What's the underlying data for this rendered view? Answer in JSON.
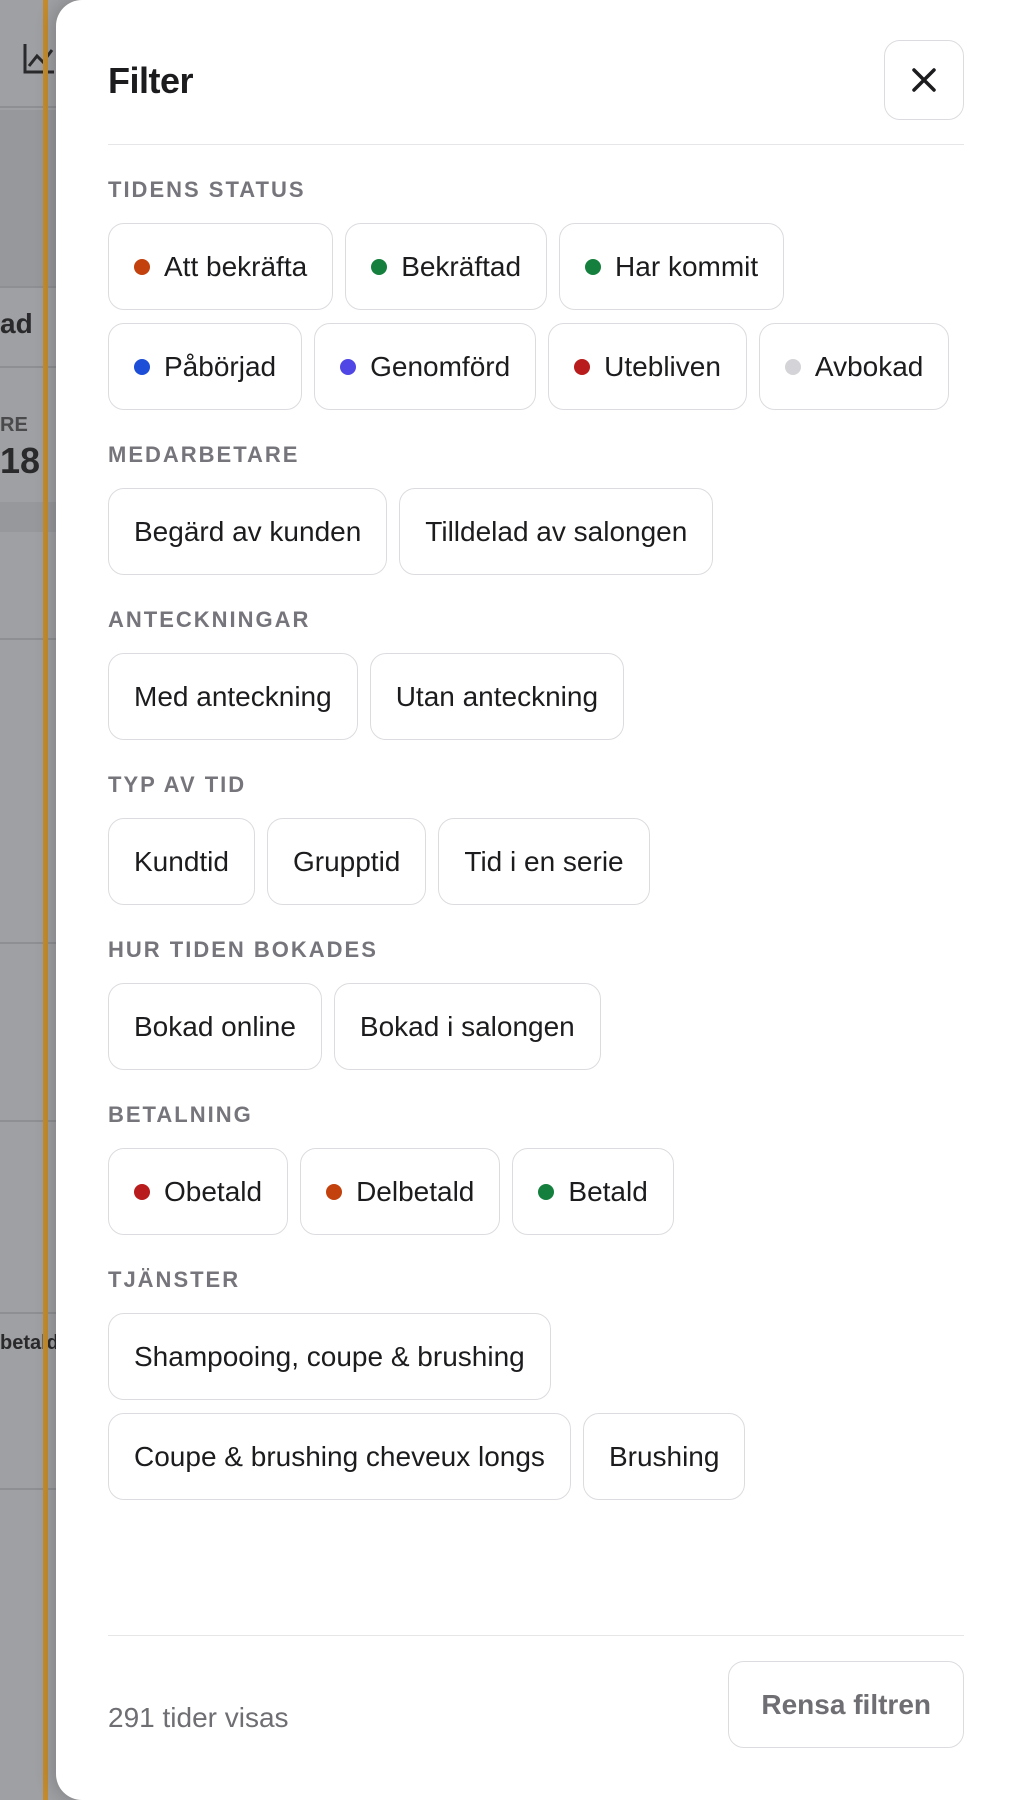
{
  "background": {
    "fragments": [
      "ad",
      "RE",
      "18",
      "betald"
    ]
  },
  "panel": {
    "title": "Filter",
    "close_icon": "close-icon"
  },
  "sections": [
    {
      "title": "TIDENS STATUS",
      "chips": [
        {
          "label": "Att bekräfta",
          "dot": "#c2410c"
        },
        {
          "label": "Bekräftad",
          "dot": "#15803d"
        },
        {
          "label": "Har kommit",
          "dot": "#15803d"
        },
        {
          "label": "Påbörjad",
          "dot": "#1d4ed8"
        },
        {
          "label": "Genomförd",
          "dot": "#4f46e5"
        },
        {
          "label": "Utebliven",
          "dot": "#b91c1c"
        },
        {
          "label": "Avbokad",
          "dot": "#d4d4d8"
        }
      ]
    },
    {
      "title": "MEDARBETARE",
      "chips": [
        {
          "label": "Begärd av kunden"
        },
        {
          "label": "Tilldelad av salongen"
        }
      ]
    },
    {
      "title": "ANTECKNINGAR",
      "chips": [
        {
          "label": "Med anteckning"
        },
        {
          "label": "Utan anteckning"
        }
      ]
    },
    {
      "title": "TYP AV TID",
      "chips": [
        {
          "label": "Kundtid"
        },
        {
          "label": "Grupptid"
        },
        {
          "label": "Tid i en serie"
        }
      ]
    },
    {
      "title": "HUR TIDEN BOKADES",
      "chips": [
        {
          "label": "Bokad online"
        },
        {
          "label": "Bokad i salongen"
        }
      ]
    },
    {
      "title": "BETALNING",
      "chips": [
        {
          "label": "Obetald",
          "dot": "#b91c1c"
        },
        {
          "label": "Delbetald",
          "dot": "#c2410c"
        },
        {
          "label": "Betald",
          "dot": "#15803d"
        }
      ]
    },
    {
      "title": "TJÄNSTER",
      "chips": [
        {
          "label": "Shampooing, coupe & brushing"
        },
        {
          "label": "Coupe & brushing cheveux longs"
        },
        {
          "label": "Brushing"
        }
      ]
    }
  ],
  "footer": {
    "count_text": "291 tider visas",
    "clear_label": "Rensa filtren"
  }
}
